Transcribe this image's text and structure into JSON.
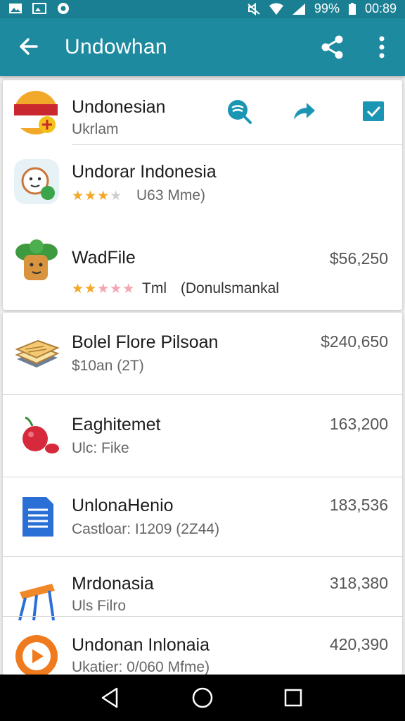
{
  "status_bar": {
    "battery": "99%",
    "time": "00:89"
  },
  "app_bar": {
    "title": "Undowhan"
  },
  "header_item": {
    "title": "Undonesian",
    "subtitle": "Ukrlam"
  },
  "featured": [
    {
      "title": "Undorar Indonesia",
      "rating_text": "U63 Mme)",
      "rating": 3
    },
    {
      "title": "WadFile",
      "rating_text": "Tml",
      "detail": "(Donulsmankal",
      "price": "$56,250",
      "rating": 2
    }
  ],
  "list": [
    {
      "title": "Bolel Flore Pilsoan",
      "subtitle": "$10an (2T)",
      "price": "$240,650",
      "icon": "books-icon"
    },
    {
      "title": "Eaghitemet",
      "subtitle": "Ulc: Fike",
      "price": "163,200",
      "icon": "cherry-icon"
    },
    {
      "title": "UnlonaHenio",
      "subtitle": "Castloar: I1209 (2Z44)",
      "price": "183,536",
      "icon": "document-icon"
    },
    {
      "title": "Mrdonasia",
      "subtitle": "Uls Filro",
      "price": "318,380",
      "icon": "easel-icon"
    },
    {
      "title": "Undonan Inlonaia",
      "subtitle": "Ukatier: 0/060 Mfme)",
      "price": "420,390",
      "icon": "play-icon"
    }
  ],
  "colors": {
    "primary": "#1d8aa0",
    "status_bar": "#1a7f93",
    "accent": "#1b95b4",
    "star": "#f2a92a"
  }
}
